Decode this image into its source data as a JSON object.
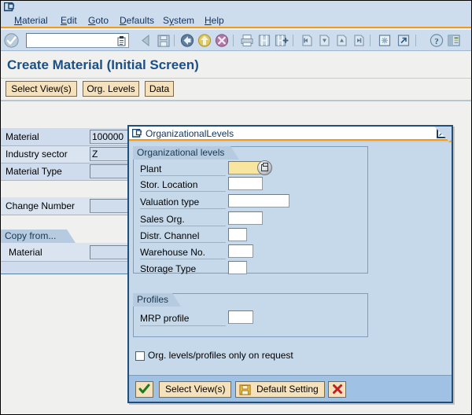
{
  "window": {
    "icon": "sap-window-icon"
  },
  "menubar": {
    "items": [
      {
        "label": "Material",
        "accel": "M"
      },
      {
        "label": "Edit",
        "accel": "E"
      },
      {
        "label": "Goto",
        "accel": "G"
      },
      {
        "label": "Defaults",
        "accel": "D"
      },
      {
        "label": "System",
        "accel": "y"
      },
      {
        "label": "Help",
        "accel": "H"
      }
    ]
  },
  "toolbar": {
    "ok_icon": "enter-check-icon",
    "command_field": {
      "value": "",
      "placeholder": "",
      "dropdown_icon": "command-history-icon"
    },
    "icons": [
      "back-arrow-icon",
      "save-icon",
      "back-globe-icon",
      "exit-globe-icon",
      "cancel-globe-icon",
      "print-icon",
      "find-icon",
      "find-next-icon",
      "first-page-icon",
      "previous-page-icon",
      "next-page-icon",
      "last-page-icon",
      "new-session-icon",
      "create-shortcut-icon",
      "help-icon",
      "layout-menu-icon"
    ]
  },
  "page": {
    "title": "Create Material (Initial Screen)"
  },
  "tabbar": {
    "buttons": [
      {
        "label": "Select View(s)"
      },
      {
        "label": "Org. Levels"
      },
      {
        "label": "Data"
      }
    ]
  },
  "form": {
    "fields": [
      {
        "label": "Material",
        "value": "100000"
      },
      {
        "label": "Industry sector",
        "value": "Z"
      },
      {
        "label": "Material Type",
        "value": ""
      },
      {
        "label": "Change Number",
        "value": ""
      }
    ],
    "copy_from": {
      "group_label": "Copy from...",
      "fields": [
        {
          "label": "Material",
          "value": ""
        }
      ]
    }
  },
  "dialog": {
    "title": "OrganizationalLevels",
    "title_icon": "sap-window-icon",
    "close_label": "☒",
    "org_levels": {
      "group_label": "Organizational levels",
      "fields": [
        {
          "label": "Plant",
          "value": "",
          "required": true,
          "has_f4": true
        },
        {
          "label": "Stor. Location",
          "value": "",
          "required": false,
          "has_f4": false
        },
        {
          "label": "Valuation type",
          "value": "",
          "required": false,
          "has_f4": false
        },
        {
          "label": "Sales Org.",
          "value": "",
          "required": false,
          "has_f4": false
        },
        {
          "label": "Distr. Channel",
          "value": "",
          "required": false,
          "has_f4": false
        },
        {
          "label": "Warehouse No.",
          "value": "",
          "required": false,
          "has_f4": false
        },
        {
          "label": "Storage Type",
          "value": "",
          "required": false,
          "has_f4": false
        }
      ]
    },
    "profiles": {
      "group_label": "Profiles",
      "fields": [
        {
          "label": "MRP profile",
          "value": ""
        }
      ]
    },
    "checkbox": {
      "label": "Org. levels/profiles only on request",
      "checked": false
    },
    "footer": {
      "buttons": [
        {
          "name": "continue",
          "label": "",
          "icon": "green-check-icon"
        },
        {
          "name": "select-views",
          "label": "Select View(s)",
          "icon": ""
        },
        {
          "name": "default-setting",
          "label": "Default Setting",
          "icon": "save-icon"
        },
        {
          "name": "cancel",
          "label": "",
          "icon": "red-x-icon"
        }
      ]
    }
  },
  "colors": {
    "accent_orange": "#f19a1a",
    "title_blue": "#1a4f87",
    "dialog_border": "#1f4f7a",
    "required_field": "#f8e6a0",
    "button_face": "#f5e2bd"
  }
}
